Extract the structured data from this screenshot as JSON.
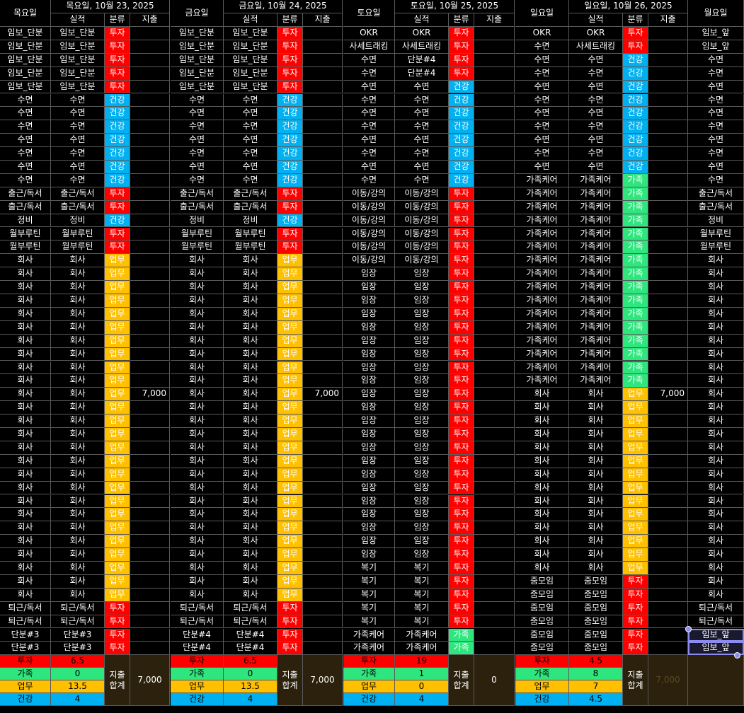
{
  "colors": {
    "invest": "#ff0000",
    "health": "#00b0f0",
    "work": "#ffc000",
    "family": "#2ee67d",
    "summary_bg": "#2b210d",
    "grid_line": "#5a5a5a",
    "selection": "#8c8cf0"
  },
  "days": [
    {
      "name": "목요일",
      "date": "목요일, 10월 23, 2025",
      "sub": [
        "실적",
        "분류",
        "지출"
      ],
      "plan": [
        "임보_단분",
        "임보_단분",
        "임보_단분",
        "임보_단분",
        "임보_단분",
        "수면",
        "수면",
        "수면",
        "수면",
        "수면",
        "수면",
        "수면",
        "출근/독서",
        "출근/독서",
        "정비",
        "월부루틴",
        "월부루틴",
        "회사",
        "회사",
        "회사",
        "회사",
        "회사",
        "회사",
        "회사",
        "회사",
        "회사",
        "회사",
        "회사",
        "회사",
        "회사",
        "회사",
        "회사",
        "회사",
        "회사",
        "회사",
        "회사",
        "회사",
        "회사",
        "회사",
        "회사",
        "회사",
        "회사",
        "회사",
        "퇴근/독서",
        "퇴근/독서",
        "단분#3",
        "단분#3"
      ],
      "actual": [
        "임보_단분",
        "임보_단분",
        "임보_단분",
        "임보_단분",
        "임보_단분",
        "수면",
        "수면",
        "수면",
        "수면",
        "수면",
        "수면",
        "수면",
        "출근/독서",
        "출근/독서",
        "정비",
        "월부루틴",
        "월부루틴",
        "회사",
        "회사",
        "회사",
        "회사",
        "회사",
        "회사",
        "회사",
        "회사",
        "회사",
        "회사",
        "회사",
        "회사",
        "회사",
        "회사",
        "회사",
        "회사",
        "회사",
        "회사",
        "회사",
        "회사",
        "회사",
        "회사",
        "회사",
        "회사",
        "회사",
        "회사",
        "퇴근/독서",
        "퇴근/독서",
        "단분#3",
        "단분#3"
      ],
      "cat": [
        "투자",
        "투자",
        "투자",
        "투자",
        "투자",
        "건강",
        "건강",
        "건강",
        "건강",
        "건강",
        "건강",
        "건강",
        "투자",
        "투자",
        "건강",
        "투자",
        "투자",
        "업무",
        "업무",
        "업무",
        "업무",
        "업무",
        "업무",
        "업무",
        "업무",
        "업무",
        "업무",
        "업무",
        "업무",
        "업무",
        "업무",
        "업무",
        "업무",
        "업무",
        "업무",
        "업무",
        "업무",
        "업무",
        "업무",
        "업무",
        "업무",
        "업무",
        "업무",
        "투자",
        "투자",
        "투자",
        "투자"
      ],
      "expense": {
        "row": 27,
        "value": "7,000"
      },
      "summary": {
        "labels": [
          "투자",
          "가족",
          "업무",
          "건강"
        ],
        "values": [
          "6.5",
          "0",
          "13.5",
          "4"
        ],
        "total_label": "지출 합계",
        "total": "7,000"
      }
    },
    {
      "name": "금요일",
      "date": "금요일, 10월 24, 2025",
      "sub": [
        "실적",
        "분류",
        "지출"
      ],
      "plan": [
        "임보_단분",
        "임보_단분",
        "임보_단분",
        "임보_단분",
        "임보_단분",
        "수면",
        "수면",
        "수면",
        "수면",
        "수면",
        "수면",
        "수면",
        "출근/독서",
        "출근/독서",
        "정비",
        "월부루틴",
        "월부루틴",
        "회사",
        "회사",
        "회사",
        "회사",
        "회사",
        "회사",
        "회사",
        "회사",
        "회사",
        "회사",
        "회사",
        "회사",
        "회사",
        "회사",
        "회사",
        "회사",
        "회사",
        "회사",
        "회사",
        "회사",
        "회사",
        "회사",
        "회사",
        "회사",
        "회사",
        "회사",
        "퇴근/독서",
        "퇴근/독서",
        "단분#4",
        "단분#4"
      ],
      "actual": [
        "임보_단분",
        "임보_단분",
        "임보_단분",
        "임보_단분",
        "임보_단분",
        "수면",
        "수면",
        "수면",
        "수면",
        "수면",
        "수면",
        "수면",
        "출근/독서",
        "출근/독서",
        "정비",
        "월부루틴",
        "월부루틴",
        "회사",
        "회사",
        "회사",
        "회사",
        "회사",
        "회사",
        "회사",
        "회사",
        "회사",
        "회사",
        "회사",
        "회사",
        "회사",
        "회사",
        "회사",
        "회사",
        "회사",
        "회사",
        "회사",
        "회사",
        "회사",
        "회사",
        "회사",
        "회사",
        "회사",
        "회사",
        "퇴근/독서",
        "퇴근/독서",
        "단분#4",
        "단분#4"
      ],
      "cat": [
        "투자",
        "투자",
        "투자",
        "투자",
        "투자",
        "건강",
        "건강",
        "건강",
        "건강",
        "건강",
        "건강",
        "건강",
        "투자",
        "투자",
        "건강",
        "투자",
        "투자",
        "업무",
        "업무",
        "업무",
        "업무",
        "업무",
        "업무",
        "업무",
        "업무",
        "업무",
        "업무",
        "업무",
        "업무",
        "업무",
        "업무",
        "업무",
        "업무",
        "업무",
        "업무",
        "업무",
        "업무",
        "업무",
        "업무",
        "업무",
        "업무",
        "업무",
        "업무",
        "투자",
        "투자",
        "투자",
        "투자"
      ],
      "expense": {
        "row": 27,
        "value": "7,000"
      },
      "summary": {
        "labels": [
          "투자",
          "가족",
          "업무",
          "건강"
        ],
        "values": [
          "6.5",
          "0",
          "13.5",
          "4"
        ],
        "total_label": "지출 합계",
        "total": "7,000"
      }
    },
    {
      "name": "토요일",
      "date": "토요일, 10월 25, 2025",
      "sub": [
        "실적",
        "분류",
        "지출"
      ],
      "plan": [
        "OKR",
        "사세트래킹",
        "수면",
        "수면",
        "수면",
        "수면",
        "수면",
        "수면",
        "수면",
        "수면",
        "수면",
        "수면",
        "이동/강의",
        "이동/강의",
        "이동/강의",
        "이동/강의",
        "이동/강의",
        "이동/강의",
        "임장",
        "임장",
        "임장",
        "임장",
        "임장",
        "임장",
        "임장",
        "임장",
        "임장",
        "임장",
        "임장",
        "임장",
        "임장",
        "임장",
        "임장",
        "임장",
        "임장",
        "임장",
        "임장",
        "임장",
        "임장",
        "임장",
        "복기",
        "복기",
        "복기",
        "복기",
        "복기",
        "가족케어",
        "가족케어"
      ],
      "actual": [
        "OKR",
        "사세트래킹",
        "단분#4",
        "단분#4",
        "수면",
        "수면",
        "수면",
        "수면",
        "수면",
        "수면",
        "수면",
        "수면",
        "이동/강의",
        "이동/강의",
        "이동/강의",
        "이동/강의",
        "이동/강의",
        "이동/강의",
        "임장",
        "임장",
        "임장",
        "임장",
        "임장",
        "임장",
        "임장",
        "임장",
        "임장",
        "임장",
        "임장",
        "임장",
        "임장",
        "임장",
        "임장",
        "임장",
        "임장",
        "임장",
        "임장",
        "임장",
        "임장",
        "임장",
        "복기",
        "복기",
        "복기",
        "복기",
        "복기",
        "가족케어",
        "가족케어"
      ],
      "cat": [
        "투자",
        "투자",
        "투자",
        "투자",
        "건강",
        "건강",
        "건강",
        "건강",
        "건강",
        "건강",
        "건강",
        "건강",
        "투자",
        "투자",
        "투자",
        "투자",
        "투자",
        "투자",
        "투자",
        "투자",
        "투자",
        "투자",
        "투자",
        "투자",
        "투자",
        "투자",
        "투자",
        "투자",
        "투자",
        "투자",
        "투자",
        "투자",
        "투자",
        "투자",
        "투자",
        "투자",
        "투자",
        "투자",
        "투자",
        "투자",
        "투자",
        "투자",
        "투자",
        "투자",
        "투자",
        "가족",
        "가족"
      ],
      "expense": {
        "row": -1,
        "value": ""
      },
      "summary": {
        "labels": [
          "투자",
          "가족",
          "업무",
          "건강"
        ],
        "values": [
          "19",
          "1",
          "0",
          "4"
        ],
        "total_label": "지출 합계",
        "total": "0"
      }
    },
    {
      "name": "일요일",
      "date": "일요일, 10월 26, 2025",
      "sub": [
        "실적",
        "분류",
        "지출"
      ],
      "plan": [
        "OKR",
        "수면",
        "수면",
        "수면",
        "수면",
        "수면",
        "수면",
        "수면",
        "수면",
        "수면",
        "수면",
        "가족케어",
        "가족케어",
        "가족케어",
        "가족케어",
        "가족케어",
        "가족케어",
        "가족케어",
        "가족케어",
        "가족케어",
        "가족케어",
        "가족케어",
        "가족케어",
        "가족케어",
        "가족케어",
        "가족케어",
        "가족케어",
        "회사",
        "회사",
        "회사",
        "회사",
        "회사",
        "회사",
        "회사",
        "회사",
        "회사",
        "회사",
        "회사",
        "회사",
        "회사",
        "회사",
        "줌모임",
        "줌모임",
        "줌모임",
        "줌모임",
        "줌모임",
        "줌모임"
      ],
      "actual": [
        "OKR",
        "사세트래킹",
        "수면",
        "수면",
        "수면",
        "수면",
        "수면",
        "수면",
        "수면",
        "수면",
        "수면",
        "가족케어",
        "가족케어",
        "가족케어",
        "가족케어",
        "가족케어",
        "가족케어",
        "가족케어",
        "가족케어",
        "가족케어",
        "가족케어",
        "가족케어",
        "가족케어",
        "가족케어",
        "가족케어",
        "가족케어",
        "가족케어",
        "회사",
        "회사",
        "회사",
        "회사",
        "회사",
        "회사",
        "회사",
        "회사",
        "회사",
        "회사",
        "회사",
        "회사",
        "회사",
        "회사",
        "줌모임",
        "줌모임",
        "줌모임",
        "줌모임",
        "줌모임",
        "줌모임"
      ],
      "cat": [
        "투자",
        "투자",
        "건강",
        "건강",
        "건강",
        "건강",
        "건강",
        "건강",
        "건강",
        "건강",
        "건강",
        "가족",
        "가족",
        "가족",
        "가족",
        "가족",
        "가족",
        "가족",
        "가족",
        "가족",
        "가족",
        "가족",
        "가족",
        "가족",
        "가족",
        "가족",
        "가족",
        "업무",
        "업무",
        "업무",
        "업무",
        "업무",
        "업무",
        "업무",
        "업무",
        "업무",
        "업무",
        "업무",
        "업무",
        "업무",
        "업무",
        "투자",
        "투자",
        "투자",
        "투자",
        "투자",
        "투자"
      ],
      "expense": {
        "row": 27,
        "value": "7,000"
      },
      "summary": {
        "labels": [
          "투자",
          "가족",
          "업무",
          "건강"
        ],
        "values": [
          "4.5",
          "8",
          "7",
          "4.5"
        ],
        "total_label": "지출 합계",
        "total": "7,000"
      }
    }
  ],
  "last_day": {
    "name": "월요일",
    "plan": [
      "임보_앞",
      "임보_앞",
      "수면",
      "수면",
      "수면",
      "수면",
      "수면",
      "수면",
      "수면",
      "수면",
      "수면",
      "수면",
      "출근/독서",
      "출근/독서",
      "정비",
      "월부루틴",
      "월부루틴",
      "회사",
      "회사",
      "회사",
      "회사",
      "회사",
      "회사",
      "회사",
      "회사",
      "회사",
      "회사",
      "회사",
      "회사",
      "회사",
      "회사",
      "회사",
      "회사",
      "회사",
      "회사",
      "회사",
      "회사",
      "회사",
      "회사",
      "회사",
      "회사",
      "회사",
      "회사",
      "퇴근/독서",
      "퇴근/독서",
      "임보_앞",
      "임보_앞"
    ]
  }
}
